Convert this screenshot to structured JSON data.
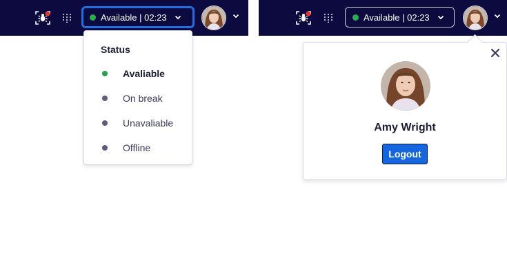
{
  "colors": {
    "topbar": "#0c0a3e",
    "available": "#22b24c",
    "focus_ring": "#1f6fe5",
    "logout_button": "#1466e0"
  },
  "left": {
    "topbar": {
      "bug_icon": "bug-with-alert-icon",
      "grid_icon": "dial-pad-icon",
      "status_text": "Available | 02:23",
      "avatar_icon": "user-avatar",
      "chevron_icon": "chevron-down-icon"
    },
    "status_menu": {
      "title": "Status",
      "items": [
        {
          "label": "Avaliable",
          "selected": true
        },
        {
          "label": "On break"
        },
        {
          "label": "Unavaliable"
        },
        {
          "label": "Offline"
        }
      ]
    }
  },
  "right": {
    "topbar": {
      "status_text": "Available | 02:23"
    },
    "profile_popover": {
      "name": "Amy Wright",
      "logout_label": "Logout",
      "close_icon": "close-icon"
    }
  }
}
